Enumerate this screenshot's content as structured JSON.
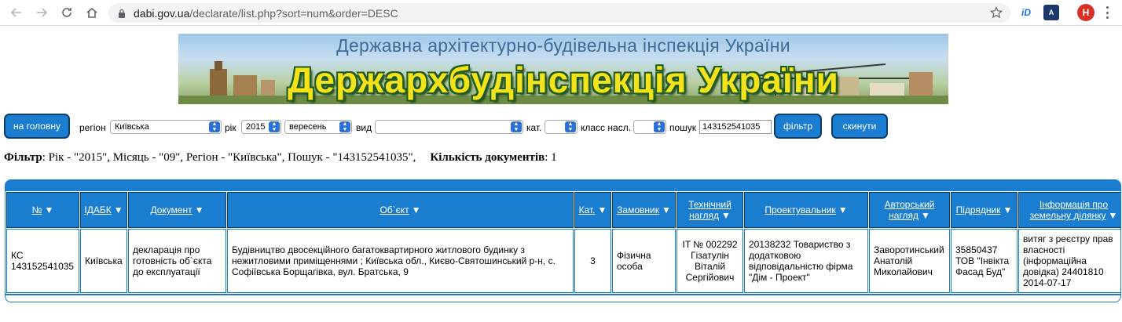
{
  "browser": {
    "url_host": "dabi.gov.ua",
    "url_path": "/declarate/list.php?sort=num&order=DESC",
    "avatar_letter": "H",
    "ext_1_label": "iD",
    "ext_2_label": "A"
  },
  "banner": {
    "subtitle": "Державна архітектурно-будівельна інспекція України",
    "title": "Держархбудінспекція України"
  },
  "filters": {
    "home_button": "на головну",
    "region_label": "регіон",
    "region_value": "Київська",
    "year_label": "рік",
    "year_value": "2015",
    "month_value": "вересень",
    "type_label": "вид",
    "type_value": "",
    "category_label": "кат.",
    "category_value": "",
    "class_label": "класс насл.",
    "class_value": "",
    "search_label": "пошук",
    "search_value": "143152541035",
    "filter_button": "фільтр",
    "reset_button": "скинути"
  },
  "summary": {
    "filter_label": "Фільтр",
    "filter_text": ": Рік - \"2015\", Місяць - \"09\", Регіон - \"Київська\", Пошук - \"143152541035\",",
    "count_label": "Кількість документів",
    "count_value": ": 1"
  },
  "table": {
    "columns": [
      {
        "label": "№"
      },
      {
        "label": "ІДАБК"
      },
      {
        "label": "Документ"
      },
      {
        "label": "Об`єкт"
      },
      {
        "label": "Кат."
      },
      {
        "label": "Замовник"
      },
      {
        "label": "Технічний нагляд"
      },
      {
        "label": "Проектувальник"
      },
      {
        "label": "Авторський нагляд"
      },
      {
        "label": "Підрядник"
      },
      {
        "label": "Інформація про земельну ділянку"
      }
    ],
    "rows": [
      {
        "num": "КС 143152541035",
        "idabk": "Київська",
        "document": "декларація про готовність об`єкта до експлуатації",
        "object": "Будівництво двосекційного багатоквартирного житлового будинку з нежитловими приміщеннями ; Київська обл., Києво-Святошинський р-н, с. Софіївська Борщагівка, вул. Братська, 9",
        "category": "3",
        "customer": "Фізична особа",
        "tech_supervision": "IT № 002292 Гізатулін Віталій Сергійович",
        "designer": "20138232 Товариство з додатковою відповідальністю фірма \"Дім - Проект\"",
        "author_supervision": "Заворотинський Анатолій Миколайович",
        "contractor": "35850437 ТОВ \"Інвікта Фасад Буд\"",
        "land_info": "витяг з реєстру прав власності (інформаційна довідка) 24401810 2014-07-17"
      }
    ]
  },
  "colors": {
    "accent_blue": "#1a7dcf",
    "dark_border": "#0c3e6b",
    "banner_title": "#f4e21a"
  }
}
